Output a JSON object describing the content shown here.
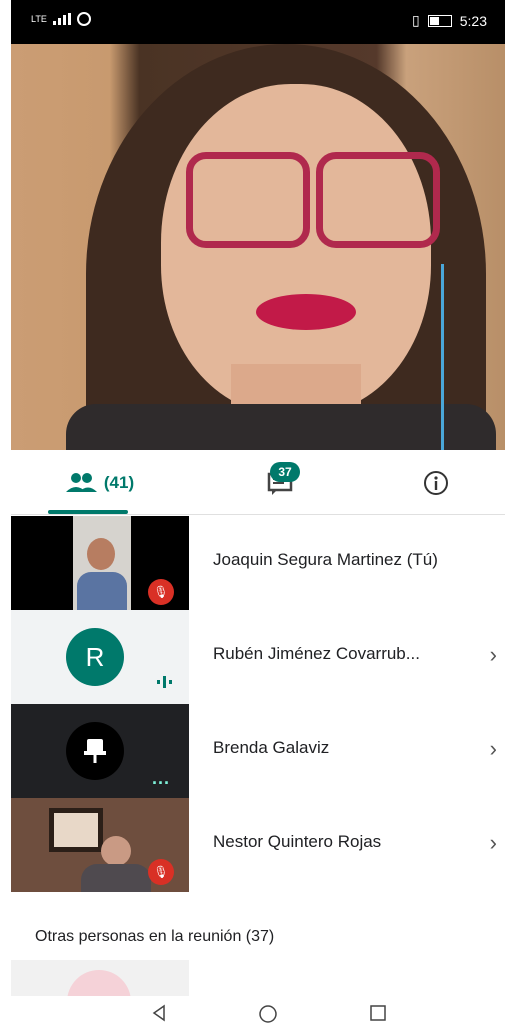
{
  "status_bar": {
    "time": "5:23",
    "carrier": "LTE"
  },
  "tabs": {
    "people_count": "(41)",
    "chat_badge": "37"
  },
  "participants": [
    {
      "name": "Joaquin Segura Martinez (Tú)",
      "muted": true,
      "has_chevron": false
    },
    {
      "name": "Rubén Jiménez Covarrub...",
      "avatar_letter": "R",
      "avatar_color": "#00796b",
      "speaking": true,
      "has_chevron": true
    },
    {
      "name": "Brenda Galaviz",
      "icon": "pin-icon",
      "activity": "...",
      "has_chevron": true
    },
    {
      "name": "Nestor Quintero Rojas",
      "muted": true,
      "has_chevron": true
    }
  ],
  "section": {
    "label": "Otras personas en la reunión (37)"
  },
  "colors": {
    "accent": "#00796b",
    "mute_red": "#d93025"
  }
}
